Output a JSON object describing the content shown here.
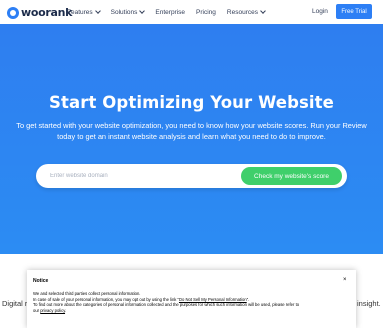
{
  "nav": {
    "logo_text": "woorank",
    "links": [
      "Features",
      "Solutions",
      "Enterprise",
      "Pricing",
      "Resources"
    ],
    "login": "Login",
    "free_trial": "Free Trial"
  },
  "hero": {
    "title": "Start Optimizing Your Website",
    "subtitle": "To get started with your website optimization, you need to know how your website scores. Run your Review today to get an instant website analysis and learn what you need to do to improve.",
    "search_placeholder": "Enter website domain",
    "search_button": "Check my website's score"
  },
  "below": {
    "left_text": "Digital r",
    "right_text": "insight."
  },
  "notice": {
    "title": "Notice",
    "close": "×",
    "line1": "We and selected third parties collect personal information.",
    "line2_pre": "In case of sale of your personal information, you may opt out by using the link “",
    "line2_link": "Do Not Sell My Personal Information",
    "line2_post": "”.",
    "line3": "To find out more about the categories of personal information collected and the purposes for which such information will be used, please refer to",
    "line4_pre": "our ",
    "line4_link": "privacy policy",
    "line4_post": "."
  },
  "colors": {
    "brand_blue": "#2d7ff5",
    "cta_green": "#3fcf6b"
  }
}
